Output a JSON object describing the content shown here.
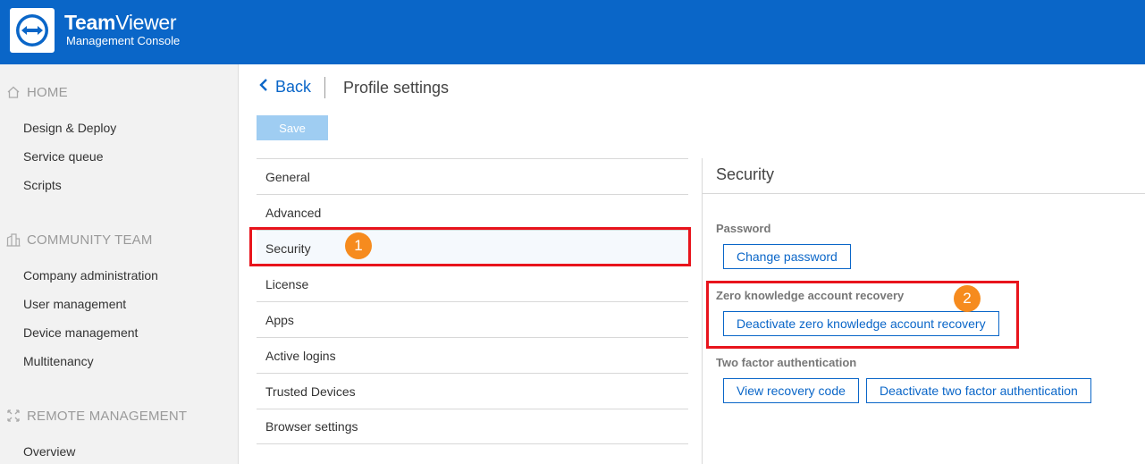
{
  "header": {
    "brand_bold": "Team",
    "brand_light": "Viewer",
    "subtitle": "Management Console",
    "logo_icon": "teamviewer-arrows-icon"
  },
  "sidebar": {
    "sections": [
      {
        "title": "HOME",
        "icon": "home-icon",
        "items": [
          "Design & Deploy",
          "Service queue",
          "Scripts"
        ]
      },
      {
        "title": "COMMUNITY TEAM",
        "icon": "buildings-icon",
        "items": [
          "Company administration",
          "User management",
          "Device management",
          "Multitenancy"
        ]
      },
      {
        "title": "REMOTE MANAGEMENT",
        "icon": "remote-management-icon",
        "items": [
          "Overview"
        ]
      }
    ]
  },
  "page": {
    "back_label": "Back",
    "title": "Profile settings",
    "save_label": "Save"
  },
  "settings_menu": {
    "items": [
      "General",
      "Advanced",
      "Security",
      "License",
      "Apps",
      "Active logins",
      "Trusted Devices",
      "Browser settings"
    ],
    "selected": "Security"
  },
  "security": {
    "title": "Security",
    "password_label": "Password",
    "change_password": "Change password",
    "zk_label": "Zero knowledge account recovery",
    "zk_deactivate": "Deactivate zero knowledge account recovery",
    "tfa_label": "Two factor authentication",
    "view_recovery": "View recovery code",
    "tfa_deactivate": "Deactivate two factor authentication"
  },
  "annotations": {
    "step1": "1",
    "step2": "2"
  },
  "colors": {
    "brand_blue": "#0a66c8",
    "highlight_red": "#e8141c",
    "badge_orange": "#f68b1e"
  }
}
